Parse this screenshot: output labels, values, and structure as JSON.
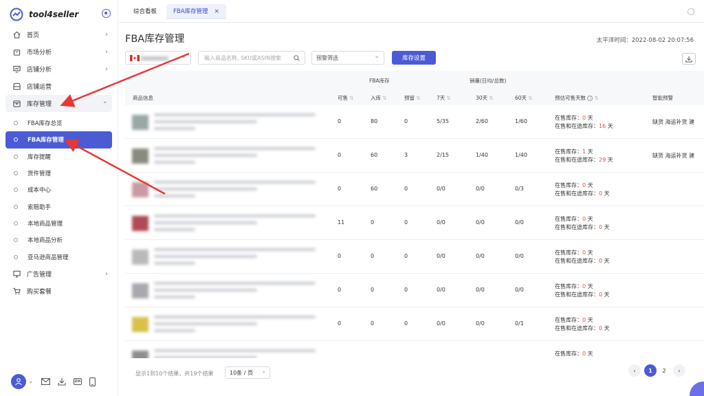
{
  "app": {
    "name": "tool4seller"
  },
  "sidebar": {
    "items": [
      {
        "label": "首页",
        "icon": "home-icon",
        "chevron": "›"
      },
      {
        "label": "市场分析",
        "icon": "bag-icon",
        "chevron": "›"
      },
      {
        "label": "店铺分析",
        "icon": "monitor-chart-icon",
        "chevron": "›"
      },
      {
        "label": "店铺运营",
        "icon": "store-icon",
        "chevron": ""
      },
      {
        "label": "库存管理",
        "icon": "box-icon",
        "chevron": "⌄"
      }
    ],
    "sub_items": [
      {
        "label": "FBA库存总览"
      },
      {
        "label": "FBA库存管理"
      },
      {
        "label": "库存提醒"
      },
      {
        "label": "货件管理"
      },
      {
        "label": "成本中心"
      },
      {
        "label": "索赔助手"
      },
      {
        "label": "本地商品管理"
      },
      {
        "label": "本地商品分析"
      },
      {
        "label": "亚马逊商品管理"
      }
    ],
    "items_after": [
      {
        "label": "广告管理",
        "icon": "screen-icon",
        "chevron": "›"
      },
      {
        "label": "购买套餐",
        "icon": "cart-icon",
        "chevron": ""
      }
    ],
    "bottom_icons": [
      "user-icon",
      "mail-icon",
      "download-icon",
      "zh-icon",
      "phone-icon"
    ],
    "zh_label": "ZH"
  },
  "tabs": [
    {
      "label": "综合看板"
    },
    {
      "label": "FBA库存管理",
      "close": "×"
    }
  ],
  "page": {
    "title": "FBA库存管理",
    "timezone_label": "太平洋时间：2022-08-02 20:07:56"
  },
  "filters": {
    "search_placeholder": "输入商品名称, SKU或ASIN搜索",
    "alert_filter": "预警筛选",
    "settings_button": "库存设置"
  },
  "table": {
    "group_headers": {
      "fba_stock": "FBA库存",
      "sales": "销量(日均/总数)"
    },
    "columns": {
      "product": "商品信息",
      "available": "可售",
      "inbound": "入库",
      "reserved": "预留",
      "d7": "7天",
      "d30": "30天",
      "d60": "60天",
      "est_days": "预估可售天数",
      "smart_alert": "智能预警"
    },
    "stock_labels": {
      "on_sale": "在售库存：",
      "on_sale_inbound": "在售和在途库存：",
      "unit": " 天"
    },
    "rows": [
      {
        "available": "0",
        "inbound": "80",
        "reserved": "0",
        "d7": "5/35",
        "d30": "2/60",
        "d60": "1/60",
        "on_sale_days": "0",
        "total_days": "16",
        "alert": "缺货 海运补货 建"
      },
      {
        "available": "0",
        "inbound": "60",
        "reserved": "3",
        "d7": "2/15",
        "d30": "1/40",
        "d60": "1/40",
        "on_sale_days": "1",
        "total_days": "29",
        "alert": "缺货 海运补货 建"
      },
      {
        "available": "0",
        "inbound": "60",
        "reserved": "0",
        "d7": "0/0",
        "d30": "0/0",
        "d60": "0/3",
        "on_sale_days": "0",
        "total_days": "0",
        "alert": ""
      },
      {
        "available": "11",
        "inbound": "0",
        "reserved": "0",
        "d7": "0/0",
        "d30": "0/0",
        "d60": "0/0",
        "on_sale_days": "0",
        "total_days": "0",
        "alert": ""
      },
      {
        "available": "0",
        "inbound": "0",
        "reserved": "0",
        "d7": "0/0",
        "d30": "0/0",
        "d60": "0/0",
        "on_sale_days": "0",
        "total_days": "0",
        "alert": ""
      },
      {
        "available": "0",
        "inbound": "0",
        "reserved": "0",
        "d7": "0/0",
        "d30": "0/0",
        "d60": "0/0",
        "on_sale_days": "0",
        "total_days": "0",
        "alert": ""
      },
      {
        "available": "0",
        "inbound": "0",
        "reserved": "0",
        "d7": "0/0",
        "d30": "0/0",
        "d60": "0/1",
        "on_sale_days": "0",
        "total_days": "0",
        "alert": ""
      },
      {
        "available": "",
        "inbound": "",
        "reserved": "",
        "d7": "",
        "d30": "",
        "d60": "",
        "on_sale_days": "0",
        "total_days": "",
        "alert": ""
      }
    ]
  },
  "pagination": {
    "info": "显示1到10个结果，共19个结果",
    "page_size": "10条 / 页",
    "prev": "‹",
    "pages": [
      "1",
      "2"
    ],
    "next": "›"
  },
  "colors": {
    "accent": "#4b5bd6",
    "danger": "#e74c3c",
    "annotation_arrow": "#e53935"
  }
}
